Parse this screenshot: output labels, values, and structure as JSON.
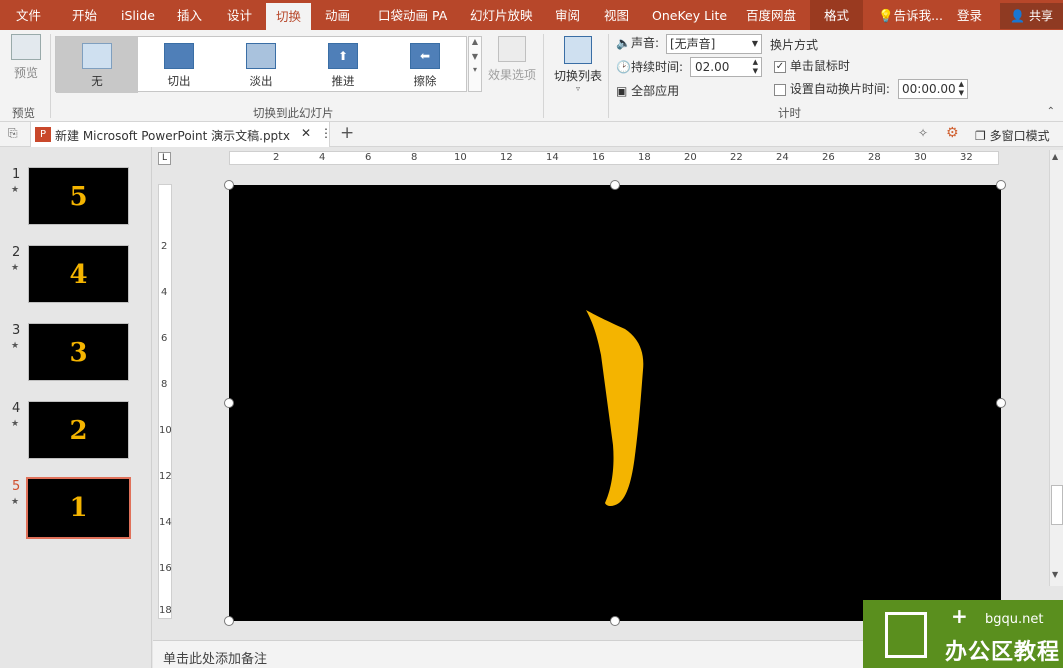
{
  "tabs": {
    "file": "文件",
    "home": "开始",
    "islide": "iSlide",
    "insert": "插入",
    "design": "设计",
    "transitions": "切换",
    "animations": "动画",
    "pocket": "口袋动画 PA",
    "slideshow": "幻灯片放映",
    "review": "审阅",
    "view": "视图",
    "onekey": "OneKey Lite",
    "baidu": "百度网盘",
    "format": "格式",
    "tell_me": "告诉我...",
    "login": "登录",
    "share": "共享"
  },
  "ribbon": {
    "preview_button": "预览",
    "preview_group": "预览",
    "gallery": [
      "无",
      "切出",
      "淡出",
      "推进",
      "擦除"
    ],
    "effect_options": "效果选项",
    "transition_group": "切换到此幻灯片",
    "transition_list": "切换列表",
    "sound_label": "声音:",
    "sound_value": "[无声音]",
    "duration_label": "持续时间:",
    "duration_value": "02.00",
    "apply_all": "全部应用",
    "advance_label": "换片方式",
    "on_click_label": "单击鼠标时",
    "on_click_checked": true,
    "auto_label": "设置自动换片时间:",
    "auto_checked": false,
    "auto_value": "00:00.00",
    "timing_group": "计时"
  },
  "document": {
    "title": "新建 Microsoft PowerPoint 演示文稿.pptx",
    "multiwindow": "多窗口模式"
  },
  "slides": [
    {
      "number": "1",
      "digit": "5",
      "selected": false
    },
    {
      "number": "2",
      "digit": "4",
      "selected": false
    },
    {
      "number": "3",
      "digit": "3",
      "selected": false
    },
    {
      "number": "4",
      "digit": "2",
      "selected": false
    },
    {
      "number": "5",
      "digit": "1",
      "selected": true
    }
  ],
  "ruler": {
    "horizontal": [
      "2",
      "4",
      "6",
      "8",
      "10",
      "12",
      "14",
      "16",
      "18",
      "20",
      "22",
      "24",
      "26",
      "28",
      "30",
      "32"
    ],
    "vertical": [
      "2",
      "4",
      "6",
      "8",
      "10",
      "12",
      "14",
      "16",
      "18"
    ]
  },
  "notes_placeholder": "单击此处添加备注",
  "watermark": {
    "site": "bgqu.net",
    "name": "办公区教程"
  },
  "colors": {
    "accent": "#b7472a",
    "slide_bg": "#000000",
    "digit": "#f4b400",
    "selected_border": "#e0715a",
    "watermark": "#5a8f1e"
  }
}
